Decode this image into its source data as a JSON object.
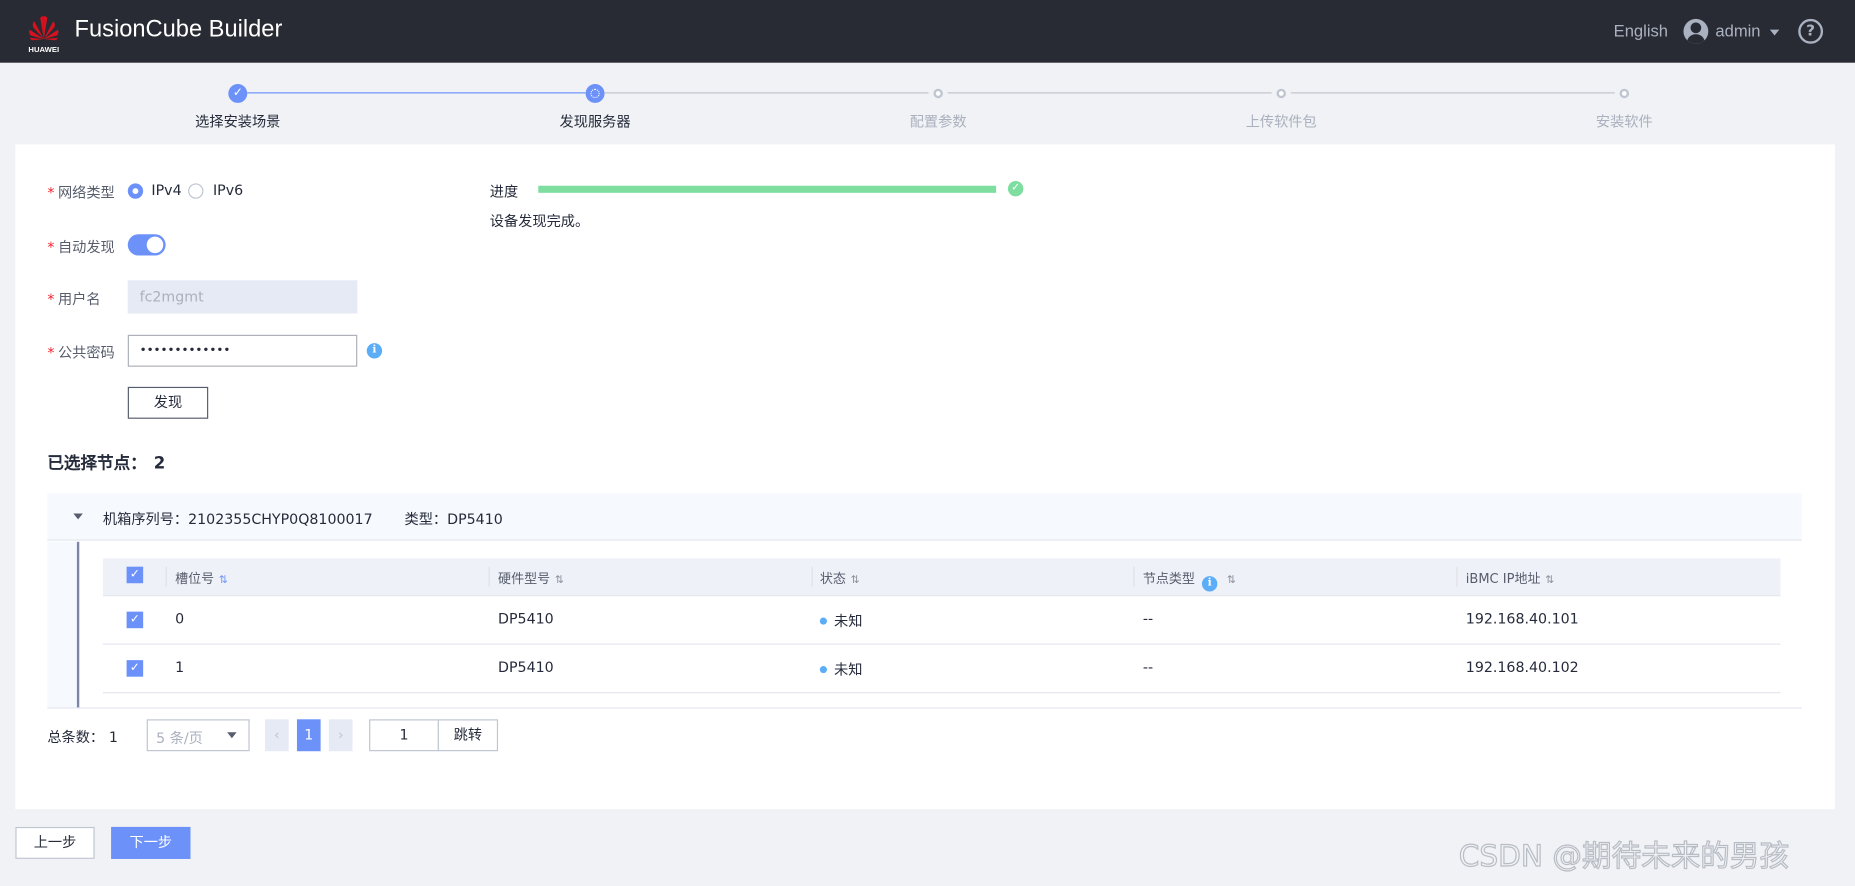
{
  "header": {
    "brand": "HUAWEI",
    "title": "FusionCube Builder",
    "language": "English",
    "user": "admin",
    "help_icon": "help-circle-icon"
  },
  "steps": [
    {
      "label": "选择安装场景",
      "state": "done"
    },
    {
      "label": "发现服务器",
      "state": "current"
    },
    {
      "label": "配置参数",
      "state": "pending"
    },
    {
      "label": "上传软件包",
      "state": "pending"
    },
    {
      "label": "安装软件",
      "state": "pending"
    }
  ],
  "form": {
    "network_type": {
      "label": "网络类型",
      "options": [
        "IPv4",
        "IPv6"
      ],
      "selected": "IPv4"
    },
    "auto_discover": {
      "label": "自动发现",
      "enabled": true
    },
    "username": {
      "label": "用户名",
      "value": "fc2mgmt",
      "disabled": true
    },
    "password": {
      "label": "公共密码",
      "value": "•••••••••••••"
    },
    "discover_button": "发现"
  },
  "progress": {
    "label": "进度",
    "percent": 100,
    "message": "设备发现完成。",
    "color": "#7ddea0"
  },
  "selected_nodes": {
    "label": "已选择节点：",
    "count": "2"
  },
  "chassis": {
    "serial_label": "机箱序列号：",
    "serial": "2102355CHYP0Q8100017",
    "type_label": "类型：",
    "type": "DP5410"
  },
  "table": {
    "columns": [
      "槽位号",
      "硬件型号",
      "状态",
      "节点类型",
      "iBMC IP地址"
    ],
    "rows": [
      {
        "checked": true,
        "slot": "0",
        "model": "DP5410",
        "status": "未知",
        "node_type": "--",
        "ip": "192.168.40.101"
      },
      {
        "checked": true,
        "slot": "1",
        "model": "DP5410",
        "status": "未知",
        "node_type": "--",
        "ip": "192.168.40.102"
      }
    ]
  },
  "pagination": {
    "total_label": "总条数：",
    "total": "1",
    "page_size": "5 条/页",
    "current_page": "1",
    "jump_value": "1",
    "jump_label": "跳转"
  },
  "footer": {
    "prev": "上一步",
    "next": "下一步"
  },
  "watermark": "CSDN @期待未来的男孩",
  "colors": {
    "accent": "#6c92fa",
    "header_bg": "#282b33",
    "success": "#7ddea0",
    "info": "#5cadf7"
  }
}
